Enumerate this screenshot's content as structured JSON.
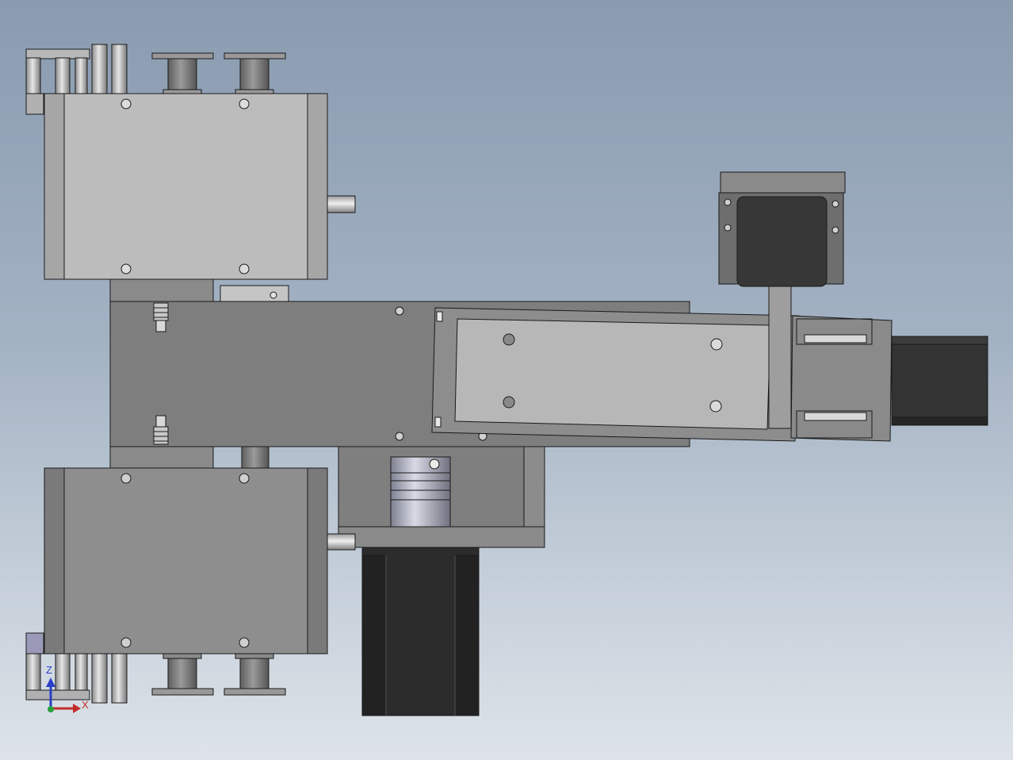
{
  "viewport": {
    "colors": {
      "background_top": "#8a9bb0",
      "background_bottom": "#dde3e9",
      "part_light": "#b5b5b5",
      "part_mid": "#8c8c8c",
      "part_dark": "#6e6e6e",
      "motor_body": "#2c2c2c",
      "edge": "#1a1a1a"
    }
  },
  "triad": {
    "z_label": "Z",
    "x_label": "X",
    "z_color": "#2b3fc9",
    "x_color": "#c22d2d",
    "origin_color": "#2aa03a"
  }
}
